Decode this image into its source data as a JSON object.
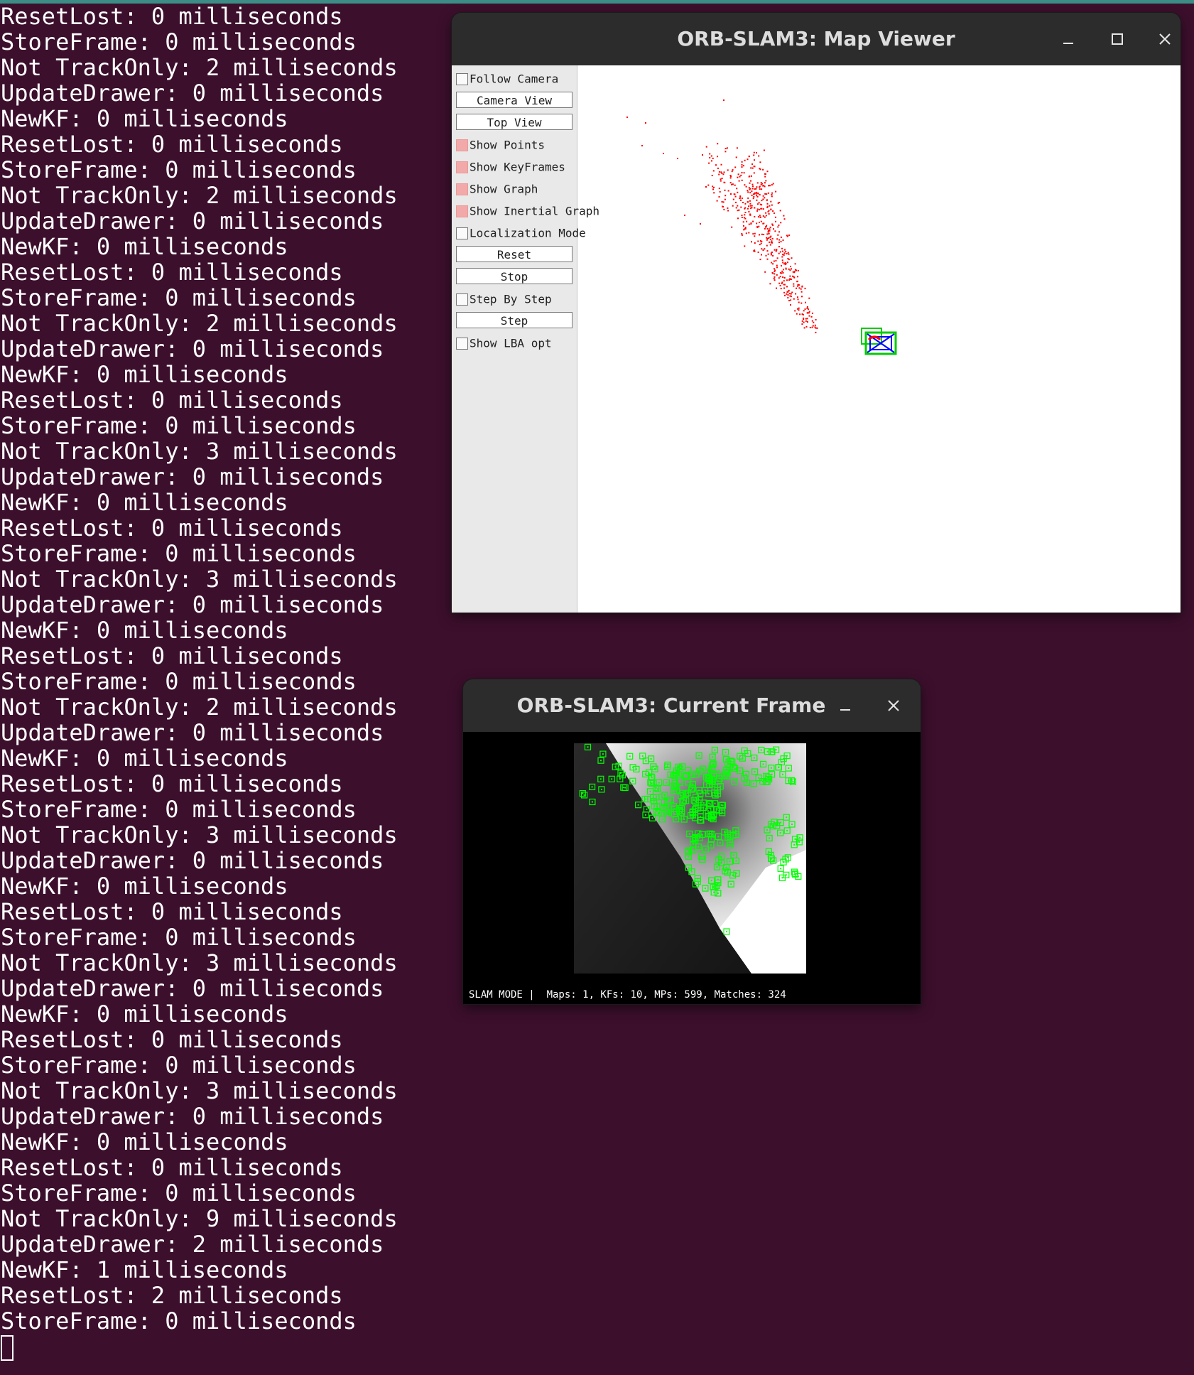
{
  "terminal": {
    "lines": [
      "ResetLost: 0 milliseconds",
      "StoreFrame: 0 milliseconds",
      "Not TrackOnly: 2 milliseconds",
      "UpdateDrawer: 0 milliseconds",
      "NewKF: 0 milliseconds",
      "ResetLost: 0 milliseconds",
      "StoreFrame: 0 milliseconds",
      "Not TrackOnly: 2 milliseconds",
      "UpdateDrawer: 0 milliseconds",
      "NewKF: 0 milliseconds",
      "ResetLost: 0 milliseconds",
      "StoreFrame: 0 milliseconds",
      "Not TrackOnly: 2 milliseconds",
      "UpdateDrawer: 0 milliseconds",
      "NewKF: 0 milliseconds",
      "ResetLost: 0 milliseconds",
      "StoreFrame: 0 milliseconds",
      "Not TrackOnly: 3 milliseconds",
      "UpdateDrawer: 0 milliseconds",
      "NewKF: 0 milliseconds",
      "ResetLost: 0 milliseconds",
      "StoreFrame: 0 milliseconds",
      "Not TrackOnly: 3 milliseconds",
      "UpdateDrawer: 0 milliseconds",
      "NewKF: 0 milliseconds",
      "ResetLost: 0 milliseconds",
      "StoreFrame: 0 milliseconds",
      "Not TrackOnly: 2 milliseconds",
      "UpdateDrawer: 0 milliseconds",
      "NewKF: 0 milliseconds",
      "ResetLost: 0 milliseconds",
      "StoreFrame: 0 milliseconds",
      "Not TrackOnly: 3 milliseconds",
      "UpdateDrawer: 0 milliseconds",
      "NewKF: 0 milliseconds",
      "ResetLost: 0 milliseconds",
      "StoreFrame: 0 milliseconds",
      "Not TrackOnly: 3 milliseconds",
      "UpdateDrawer: 0 milliseconds",
      "NewKF: 0 milliseconds",
      "ResetLost: 0 milliseconds",
      "StoreFrame: 0 milliseconds",
      "Not TrackOnly: 3 milliseconds",
      "UpdateDrawer: 0 milliseconds",
      "NewKF: 0 milliseconds",
      "ResetLost: 0 milliseconds",
      "StoreFrame: 0 milliseconds",
      "Not TrackOnly: 9 milliseconds",
      "UpdateDrawer: 2 milliseconds",
      "NewKF: 1 milliseconds",
      "ResetLost: 2 milliseconds",
      "StoreFrame: 0 milliseconds"
    ]
  },
  "map_viewer": {
    "title": "ORB-SLAM3: Map Viewer",
    "panel": {
      "follow_camera": {
        "label": "Follow Camera",
        "checked": false
      },
      "camera_view": "Camera View",
      "top_view": "Top View",
      "show_points": {
        "label": "Show Points",
        "checked": true
      },
      "show_keyframes": {
        "label": "Show KeyFrames",
        "checked": true
      },
      "show_graph": {
        "label": "Show Graph",
        "checked": true
      },
      "show_inertial_graph": {
        "label": "Show Inertial Graph",
        "checked": true
      },
      "localization_mode": {
        "label": "Localization Mode",
        "checked": false
      },
      "reset": "Reset",
      "stop": "Stop",
      "step_by_step": {
        "label": "Step By Step",
        "checked": false
      },
      "step": "Step",
      "show_lba_opt": {
        "label": "Show LBA opt",
        "checked": false
      }
    },
    "colors": {
      "map_points": "#ff0000",
      "keyframes": "#00cc00",
      "current_camera": "#0000ff"
    }
  },
  "current_frame": {
    "title": "ORB-SLAM3: Current Frame",
    "status": "SLAM MODE |  Maps: 1, KFs: 10, MPs: 599, Matches: 324",
    "colors": {
      "features": "#00ff00"
    }
  }
}
